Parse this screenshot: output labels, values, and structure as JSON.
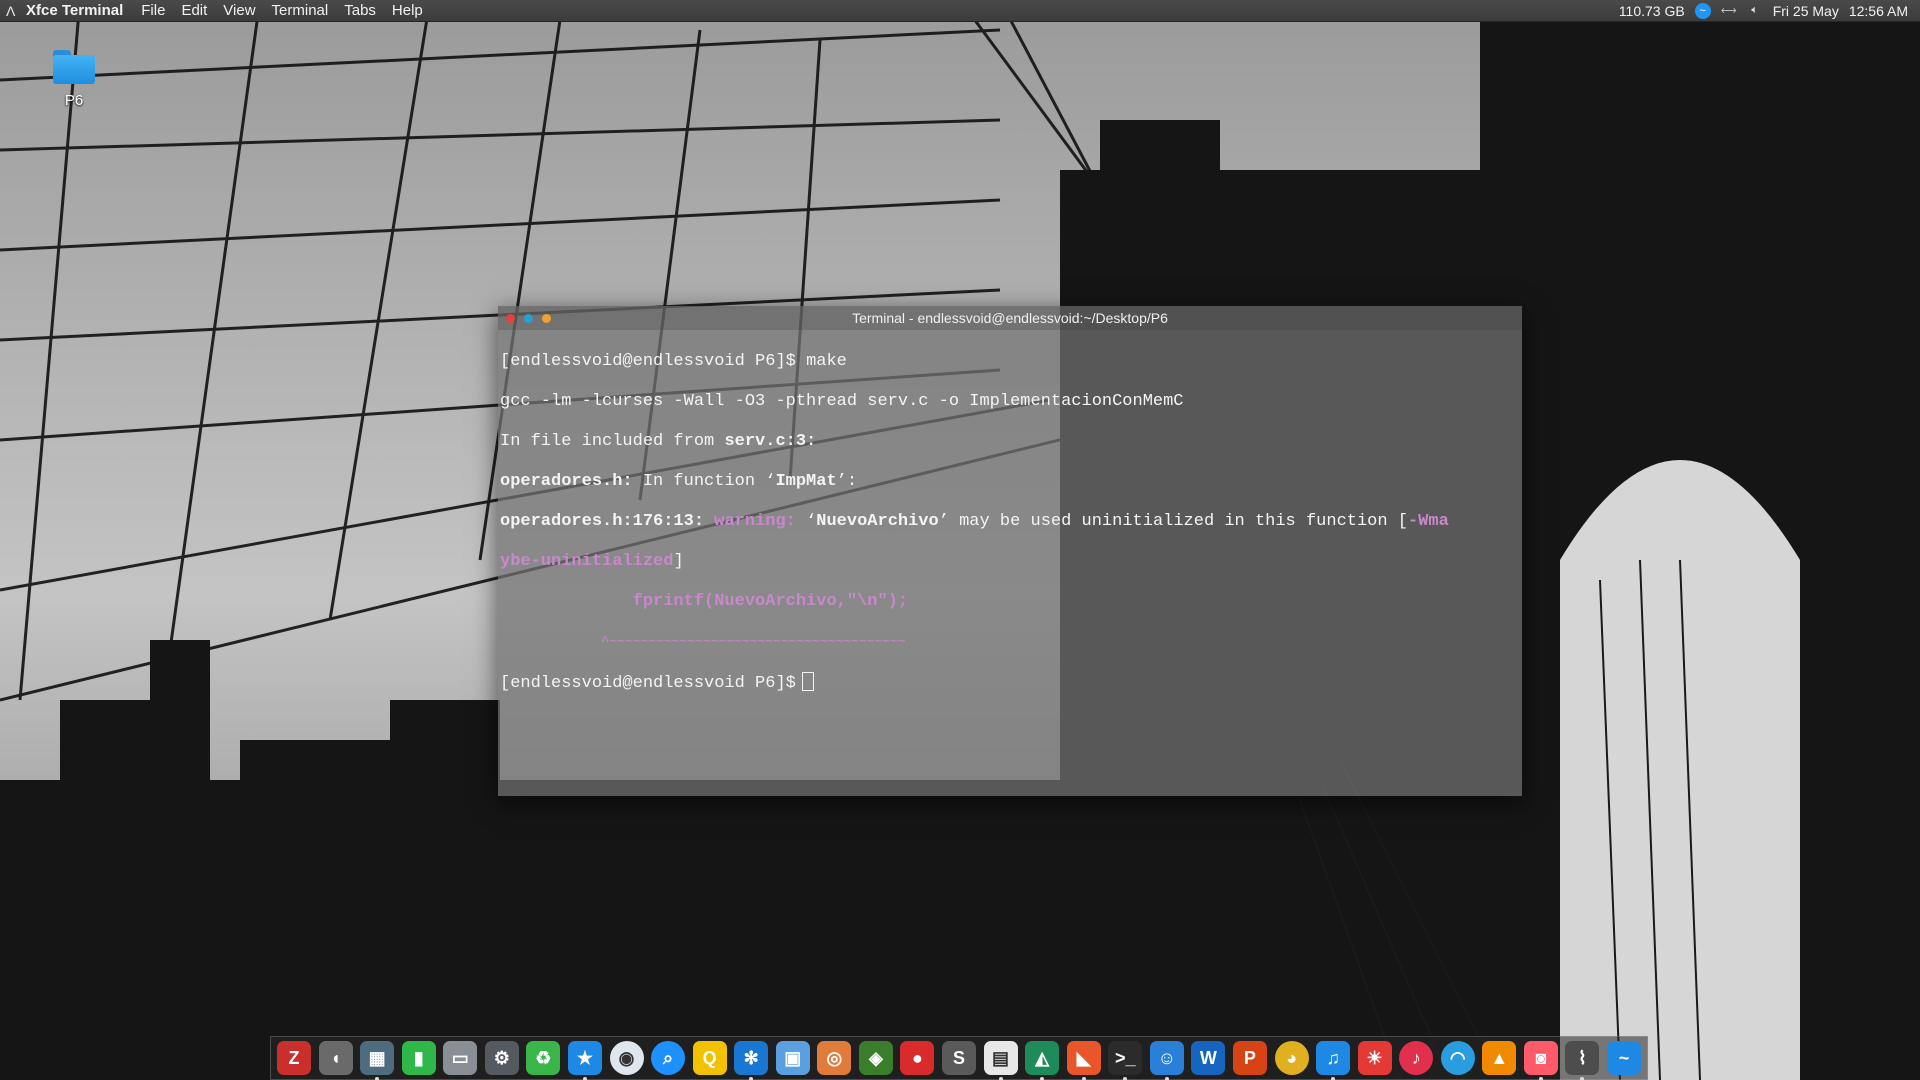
{
  "topbar": {
    "app_name": "Xfce Terminal",
    "menus": [
      "File",
      "Edit",
      "View",
      "Terminal",
      "Tabs",
      "Help"
    ],
    "disk_free": "110.73 GB",
    "date": "Fri 25 May",
    "time": "12:56 AM"
  },
  "desktop": {
    "folder_label": "P6"
  },
  "terminal": {
    "title": "Terminal - endlessvoid@endlessvoid:~/Desktop/P6",
    "prompt": "[endlessvoid@endlessvoid P6]$ ",
    "cmd": "make",
    "line2": "gcc -lm -lcurses -Wall -O3 -pthread serv.c -o ImplementacionConMemC",
    "line3_a": "In file included from ",
    "line3_b": "serv.c:3:",
    "line4_a": "operadores.h:",
    "line4_b": " In function ",
    "line4_q1": "‘",
    "line4_c": "ImpMat",
    "line4_q2": "’",
    "line4_d": ":",
    "line5_a": "operadores.h:176:13:",
    "line5_b": " warning: ",
    "line5_q1": "‘",
    "line5_c": "NuevoArchivo",
    "line5_q2": "’",
    "line5_d": " may be used uninitialized in this function [",
    "line5_e": "-Wma",
    "line6_a": "ybe-uninitialized",
    "line6_b": "]",
    "line7": "             fprintf(NuevoArchivo,\"\\n\");",
    "line8": "             ^~~~~~~~~~~~~~~~~~~~~~~~~~~~~~~~~~~~~~~",
    "prompt2": "[endlessvoid@endlessvoid P6]$"
  },
  "dock": {
    "icons": [
      {
        "name": "filezilla-icon",
        "glyph": "Z",
        "color": "#c9302c"
      },
      {
        "name": "sound-icon",
        "glyph": "◖",
        "color": "#6a6a6a"
      },
      {
        "name": "calculator-icon",
        "glyph": "▦",
        "color": "#4f6b80"
      },
      {
        "name": "notes-icon",
        "glyph": "▮",
        "color": "#2fb84a"
      },
      {
        "name": "display-icon",
        "glyph": "▭",
        "color": "#8a8f96"
      },
      {
        "name": "settings-icon",
        "glyph": "⚙",
        "color": "#555a60"
      },
      {
        "name": "recycle-icon",
        "glyph": "♻",
        "color": "#39b54a"
      },
      {
        "name": "star-icon",
        "glyph": "★",
        "color": "#1e88e5"
      },
      {
        "name": "eye-icon",
        "glyph": "◉",
        "color": "#dfe6ee"
      },
      {
        "name": "search-icon",
        "glyph": "⌕",
        "color": "#1e90ff"
      },
      {
        "name": "magnifier-icon",
        "glyph": "Q",
        "color": "#f2c200"
      },
      {
        "name": "gear-icon",
        "glyph": "✻",
        "color": "#1976d2"
      },
      {
        "name": "image-viewer-icon",
        "glyph": "▣",
        "color": "#5aa0e0"
      },
      {
        "name": "disk-icon",
        "glyph": "◎",
        "color": "#e07b39"
      },
      {
        "name": "nvidia-icon",
        "glyph": "◈",
        "color": "#3a7d2a"
      },
      {
        "name": "recorder-icon",
        "glyph": "●",
        "color": "#d92b2b"
      },
      {
        "name": "sublime-icon",
        "glyph": "S",
        "color": "#5a5a5a"
      },
      {
        "name": "document-icon",
        "glyph": "▤",
        "color": "#e8e8e8"
      },
      {
        "name": "monitor-icon",
        "glyph": "◭",
        "color": "#1f8a5a"
      },
      {
        "name": "screenshot-icon",
        "glyph": "◣",
        "color": "#e8562a"
      },
      {
        "name": "terminal-icon",
        "glyph": ">_",
        "color": "#2b2b2b"
      },
      {
        "name": "finder-icon",
        "glyph": "☺",
        "color": "#2a7fd8"
      },
      {
        "name": "writer-icon",
        "glyph": "W",
        "color": "#1565c0"
      },
      {
        "name": "presentation-icon",
        "glyph": "P",
        "color": "#d84315"
      },
      {
        "name": "chrome-icon",
        "glyph": "◕",
        "color": "#e0b020"
      },
      {
        "name": "music-icon",
        "glyph": "♫",
        "color": "#1e88e5"
      },
      {
        "name": "brightness-icon",
        "glyph": "☀",
        "color": "#e53935"
      },
      {
        "name": "itunes-icon",
        "glyph": "♪",
        "color": "#e0304e"
      },
      {
        "name": "network-icon",
        "glyph": "◠",
        "color": "#2a9de0"
      },
      {
        "name": "vlc-icon",
        "glyph": "▲",
        "color": "#f08a00"
      },
      {
        "name": "camera-icon",
        "glyph": "◙",
        "color": "#ff5a6a"
      },
      {
        "name": "system-monitor-icon",
        "glyph": "⌇",
        "color": "#4d4d4d"
      },
      {
        "name": "messenger-icon",
        "glyph": "~",
        "color": "#1e88e5"
      }
    ]
  }
}
